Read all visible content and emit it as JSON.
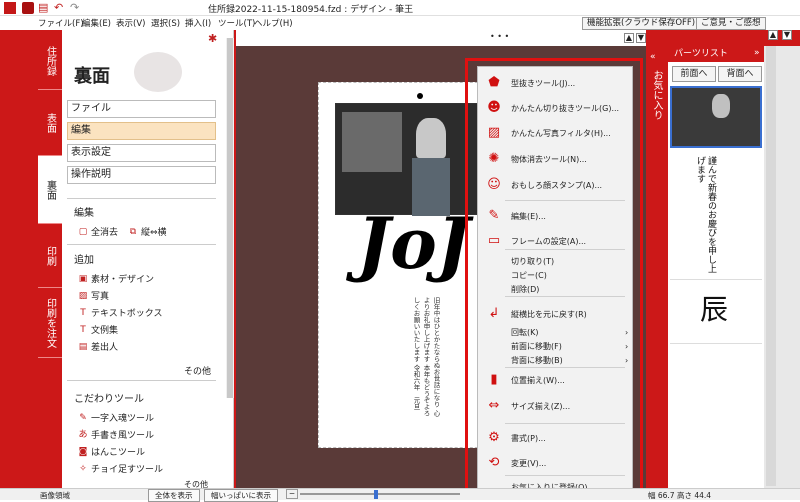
{
  "window": {
    "title": "住所録2022-11-15-180954.fzd : デザイン - 筆王"
  },
  "menu": {
    "items": [
      "ファイル(F)",
      "編集(E)",
      "表示(V)",
      "選択(S)",
      "挿入(I)",
      "ツール(T)",
      "ヘルプ(H)"
    ],
    "feature_button": "機能拡張(クラウド保存OFF)",
    "feedback_button": "ご意見・ご感想"
  },
  "left_tabs": [
    "住所録",
    "表面",
    "裏面",
    "印刷",
    "印刷を注文"
  ],
  "left": {
    "title": "裏面",
    "nav": [
      "ファイル",
      "編集",
      "表示設定",
      "操作説明"
    ],
    "edit_head": "編集",
    "edit_items": [
      "全消去",
      "縦⇔横"
    ],
    "add_head": "追加",
    "add_items": [
      "素材・デザイン",
      "写真",
      "テキストボックス",
      "文例集",
      "差出人"
    ],
    "more": "その他",
    "tools_head": "こだわりツール",
    "tools_items": [
      "一字入魂ツール",
      "手書き風ツール",
      "はんこツール",
      "チョイ足すツール"
    ],
    "more2": "その他"
  },
  "canvas": {
    "dots": "• • •",
    "calligraphy": "JoJ",
    "vertical_text": [
      "旧年中はひとかたならぬお世話になり",
      "心よりお礼申し上げます",
      "本年もどうぞよろしくお願いいたします",
      "令和六年　元旦"
    ]
  },
  "context_menu": {
    "items": [
      {
        "label": "型抜きツール(J)...",
        "icon": "pentagon-icon"
      },
      {
        "label": "かんたん切り抜きツール(G)...",
        "icon": "person-cut-icon"
      },
      {
        "label": "かんたん写真フィルタ(H)...",
        "icon": "photo-filter-icon"
      },
      {
        "label": "物体消去ツール(N)...",
        "icon": "erase-icon"
      },
      {
        "label": "おもしろ顔スタンプ(A)...",
        "icon": "face-stamp-icon"
      },
      {
        "label": "編集(E)...",
        "icon": "edit-icon"
      },
      {
        "label": "フレームの設定(A)...",
        "icon": "frame-icon"
      },
      {
        "label": "切り取り(T)",
        "icon": ""
      },
      {
        "label": "コピー(C)",
        "icon": ""
      },
      {
        "label": "削除(D)",
        "icon": ""
      },
      {
        "label": "縦横比を元に戻す(R)",
        "icon": "aspect-icon"
      },
      {
        "label": "回転(K)",
        "icon": ""
      },
      {
        "label": "前面に移動(F)",
        "icon": ""
      },
      {
        "label": "背面に移動(B)",
        "icon": ""
      },
      {
        "label": "位置揃え(W)...",
        "icon": "align-icon"
      },
      {
        "label": "サイズ揃え(Z)...",
        "icon": "size-align-icon"
      },
      {
        "label": "書式(P)...",
        "icon": "gear-icon"
      },
      {
        "label": "変更(V)...",
        "icon": "change-icon"
      },
      {
        "label": "お気に入りに登録(O)",
        "icon": ""
      }
    ]
  },
  "right": {
    "favorites_tab": "お気に入り",
    "parts_header": "パーツリスト",
    "front_button": "前面へ",
    "back_button": "背面へ",
    "greeting_text": "謹んで新春のお慶びを申し上げます",
    "dragon_char": "辰"
  },
  "status": {
    "left": "画像領域",
    "fit_all": "全体を表示",
    "fit_width": "幅いっぱいに表示",
    "size": "幅 66.7 高さ 44.4"
  },
  "colors": {
    "accent": "#cc1818",
    "highlight_frame": "#e01010",
    "canvas_bg": "#5a3a38"
  }
}
